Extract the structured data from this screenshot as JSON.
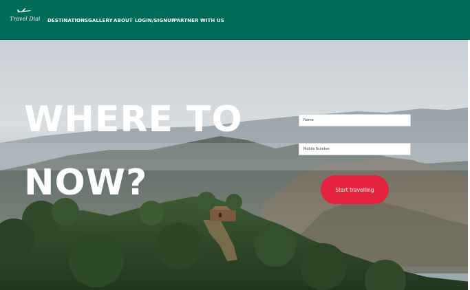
{
  "brand": {
    "name": "Travel Diai"
  },
  "nav": {
    "items": [
      {
        "label": "DESTINATIONS"
      },
      {
        "label": "GALLERY"
      },
      {
        "label": "ABOUT"
      },
      {
        "label": "LOGIN/SIGNUP"
      },
      {
        "label": "PARTNER WITH US"
      }
    ]
  },
  "hero": {
    "headline_line1": "WHERE TO",
    "headline_line2": "NOW?"
  },
  "form": {
    "name_placeholder": "Name",
    "mobile_placeholder": "Mobile Number",
    "submit_label": "Start travelling"
  },
  "colors": {
    "nav_bg": "#006b58",
    "cta": "#e4243f",
    "text_light": "#ffffff"
  }
}
